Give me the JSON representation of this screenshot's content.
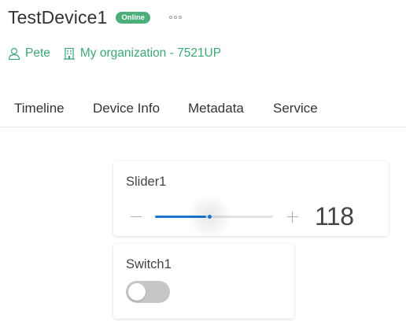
{
  "header": {
    "device_name": "TestDevice1",
    "status": "Online",
    "status_color": "#4caf7a",
    "more_icon": "more-dots-icon"
  },
  "meta": {
    "owner": "Pete",
    "owner_icon": "user-icon",
    "organization": "My organization - 7521UP",
    "organization_icon": "building-icon",
    "accent_color": "#3aa876"
  },
  "tabs": [
    {
      "label": "Timeline"
    },
    {
      "label": "Device Info"
    },
    {
      "label": "Metadata"
    },
    {
      "label": "Service"
    }
  ],
  "widgets": {
    "slider": {
      "label": "Slider1",
      "value": "118",
      "level": 0.46,
      "accent_color": "#1976d2",
      "minus_icon": "minus-icon",
      "plus_icon": "plus-icon"
    },
    "switch": {
      "label": "Switch1",
      "state": "off"
    }
  }
}
